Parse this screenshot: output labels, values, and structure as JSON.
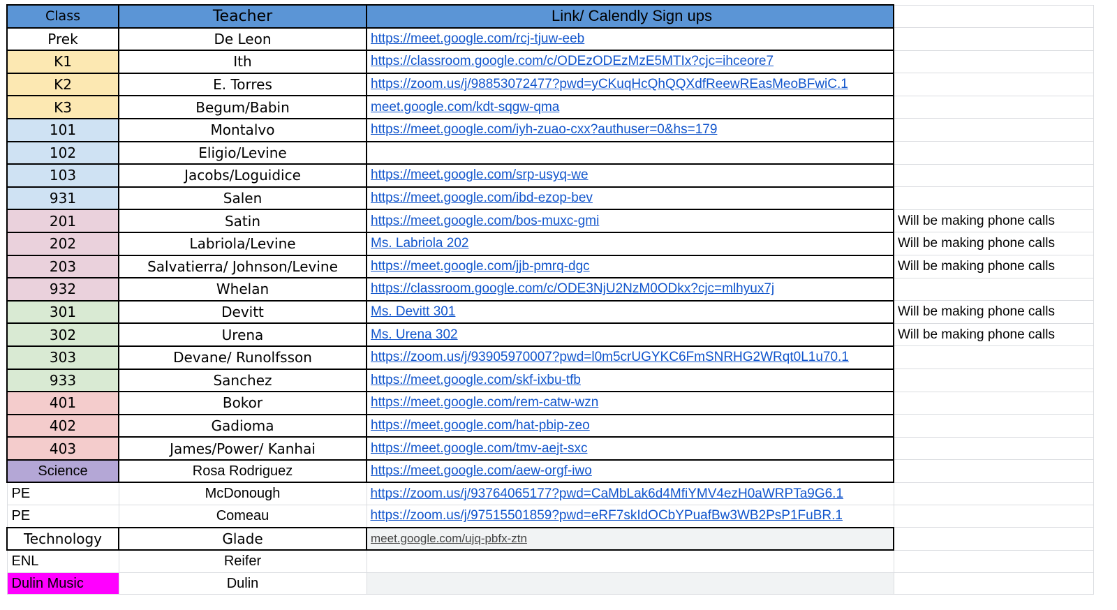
{
  "header": {
    "class": "Class",
    "teacher": "Teacher",
    "link": "Link/ Calendly Sign ups"
  },
  "colors": {
    "header_blue": "#5b95d6",
    "kinder_yellow": "#fce8b2",
    "grade1_blue": "#cfe2f3",
    "grade2_pink": "#ead1dc",
    "grade3_green": "#d9ead3",
    "grade4_red": "#f4cccc",
    "science_purple": "#b4a7d6",
    "music_magenta": "#ff00ff",
    "link_blue": "#1155cc"
  },
  "rows": [
    {
      "class": "Prek",
      "teacher": "De Leon",
      "link": "https://meet.google.com/rcj-tjuw-eeb",
      "note": ""
    },
    {
      "class": "K1",
      "teacher": "Ith",
      "link": "https://classroom.google.com/c/ODEzODEzMzE5MTIx?cjc=ihceore7",
      "note": ""
    },
    {
      "class": "K2",
      "teacher": "E. Torres",
      "link": "https://zoom.us/j/98853072477?pwd=yCKuqHcQhQQXdfReewREasMeoBFwiC.1",
      "note": ""
    },
    {
      "class": "K3",
      "teacher": "Begum/Babin",
      "link": "meet.google.com/kdt-sqgw-qma",
      "note": ""
    },
    {
      "class": "101",
      "teacher": "Montalvo",
      "link": "https://meet.google.com/iyh-zuao-cxx?authuser=0&hs=179",
      "note": ""
    },
    {
      "class": "102",
      "teacher": "Eligio/Levine",
      "link": "",
      "note": ""
    },
    {
      "class": "103",
      "teacher": "Jacobs/Loguidice",
      "link": "https://meet.google.com/srp-usyq-we",
      "note": ""
    },
    {
      "class": "931",
      "teacher": "Salen",
      "link": "https://meet.google.com/ibd-ezop-bev",
      "note": ""
    },
    {
      "class": "201",
      "teacher": "Satin",
      "link": "https://meet.google.com/bos-muxc-gmi",
      "note": "Will be making phone calls"
    },
    {
      "class": "202",
      "teacher": "Labriola/Levine",
      "link": "Ms. Labriola 202",
      "note": "Will be making phone calls"
    },
    {
      "class": "203",
      "teacher": "Salvatierra/ Johnson/Levine",
      "link": "https://meet.google.com/jjb-pmrq-dgc",
      "note": "Will be making phone calls"
    },
    {
      "class": "932",
      "teacher": "Whelan",
      "link": "https://classroom.google.com/c/ODE3NjU2NzM0ODkx?cjc=mlhyux7j",
      "note": ""
    },
    {
      "class": "301",
      "teacher": "Devitt",
      "link": "Ms. Devitt 301",
      "note": "Will be making phone calls"
    },
    {
      "class": "302",
      "teacher": "Urena",
      "link": "Ms. Urena 302",
      "note": "Will be making phone calls"
    },
    {
      "class": "303",
      "teacher": "Devane/ Runolfsson",
      "link": "https://zoom.us/j/93905970007?pwd=l0m5crUGYKC6FmSNRHG2WRqt0L1u70.1",
      "note": ""
    },
    {
      "class": "933",
      "teacher": "Sanchez",
      "link": "https://meet.google.com/skf-ixbu-tfb",
      "note": ""
    },
    {
      "class": "401",
      "teacher": "Bokor",
      "link": "https://meet.google.com/rem-catw-wzn",
      "note": ""
    },
    {
      "class": "402",
      "teacher": "Gadioma",
      "link": "https://meet.google.com/hat-pbip-zeo",
      "note": ""
    },
    {
      "class": "403",
      "teacher": "James/Power/ Kanhai",
      "link": "https://meet.google.com/tmv-aejt-sxc",
      "note": ""
    },
    {
      "class": "Science",
      "teacher": "Rosa Rodriguez",
      "link": "https://meet.google.com/aew-orgf-iwo",
      "note": ""
    },
    {
      "class": "PE",
      "teacher": "McDonough",
      "link": "https://zoom.us/j/93764065177?pwd=CaMbLak6d4MfiYMV4ezH0aWRPTa9G6.1",
      "note": ""
    },
    {
      "class": "PE",
      "teacher": "Comeau",
      "link": "https://zoom.us/j/97515501859?pwd=eRF7skIdOCbYPuafBw3WB2PsP1FuBR.1",
      "note": ""
    },
    {
      "class": "Technology",
      "teacher": "Glade",
      "link": "meet.google.com/ujq-pbfx-ztn",
      "note": ""
    },
    {
      "class": "ENL",
      "teacher": "Reifer",
      "link": "",
      "note": ""
    },
    {
      "class": "Dulin Music",
      "teacher": "Dulin",
      "link": "",
      "note": ""
    }
  ]
}
